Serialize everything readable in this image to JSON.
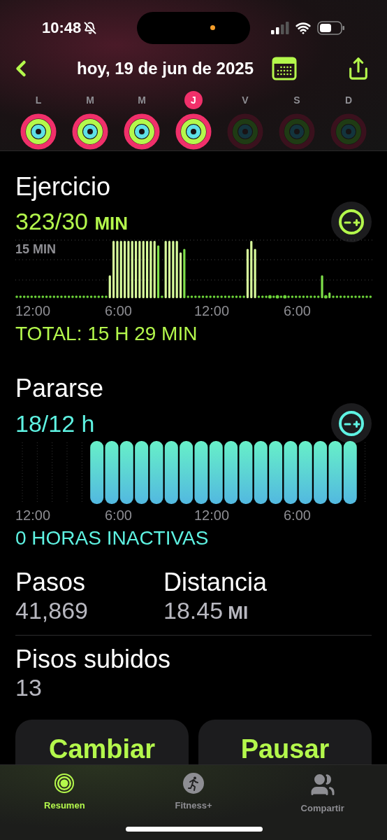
{
  "status_bar": {
    "time": "10:48"
  },
  "header": {
    "title": "hoy, 19 de jun de 2025"
  },
  "week": [
    {
      "label": "L",
      "selected": false,
      "future": false
    },
    {
      "label": "M",
      "selected": false,
      "future": false
    },
    {
      "label": "M",
      "selected": false,
      "future": false
    },
    {
      "label": "J",
      "selected": true,
      "future": false
    },
    {
      "label": "V",
      "selected": false,
      "future": true
    },
    {
      "label": "S",
      "selected": false,
      "future": true
    },
    {
      "label": "D",
      "selected": false,
      "future": true
    }
  ],
  "exercise": {
    "title": "Ejercicio",
    "value": "323/30",
    "unit": "MIN",
    "scale_label": "15 MIN",
    "x_labels": [
      "12:00",
      "6:00",
      "12:00",
      "6:00"
    ],
    "total": "TOTAL: 15 H 29 MIN"
  },
  "stand": {
    "title": "Pararse",
    "value": "18/12 h",
    "x_labels": [
      "12:00",
      "6:00",
      "12:00",
      "6:00"
    ],
    "summary": "0 HORAS INACTIVAS"
  },
  "stats": [
    {
      "label": "Pasos",
      "value": "41,869"
    },
    {
      "label": "Distancia",
      "value": "18.45",
      "unit": "MI"
    }
  ],
  "floors": {
    "label": "Pisos subidos",
    "value": "13"
  },
  "actions": [
    "Cambiar",
    "Pausar"
  ],
  "tab_bar": [
    {
      "label": "Resumen",
      "selected": true
    },
    {
      "label": "Fitness+",
      "selected": false
    },
    {
      "label": "Compartir",
      "selected": false
    }
  ]
}
